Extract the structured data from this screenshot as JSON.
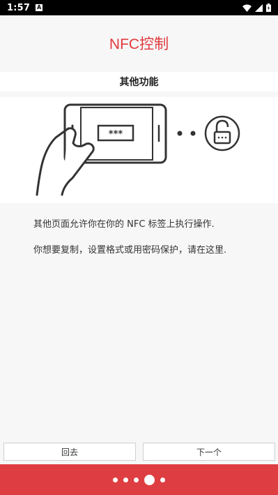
{
  "status_bar": {
    "time": "1:57",
    "notification_letter": "A"
  },
  "header": {
    "title": "NFC控制"
  },
  "section": {
    "title": "其他功能"
  },
  "content": {
    "paragraph1": "其他页面允许你在你的 NFC 标签上执行操作.",
    "paragraph2": "你想要复制，设置格式或用密码保护，请在这里."
  },
  "illustration": {
    "password_text": "***"
  },
  "buttons": {
    "back_label": "回去",
    "next_label": "下一个"
  },
  "pager": {
    "total": 5,
    "active_index": 3
  },
  "colors": {
    "accent": "#de3e42",
    "title": "#e0393e"
  }
}
